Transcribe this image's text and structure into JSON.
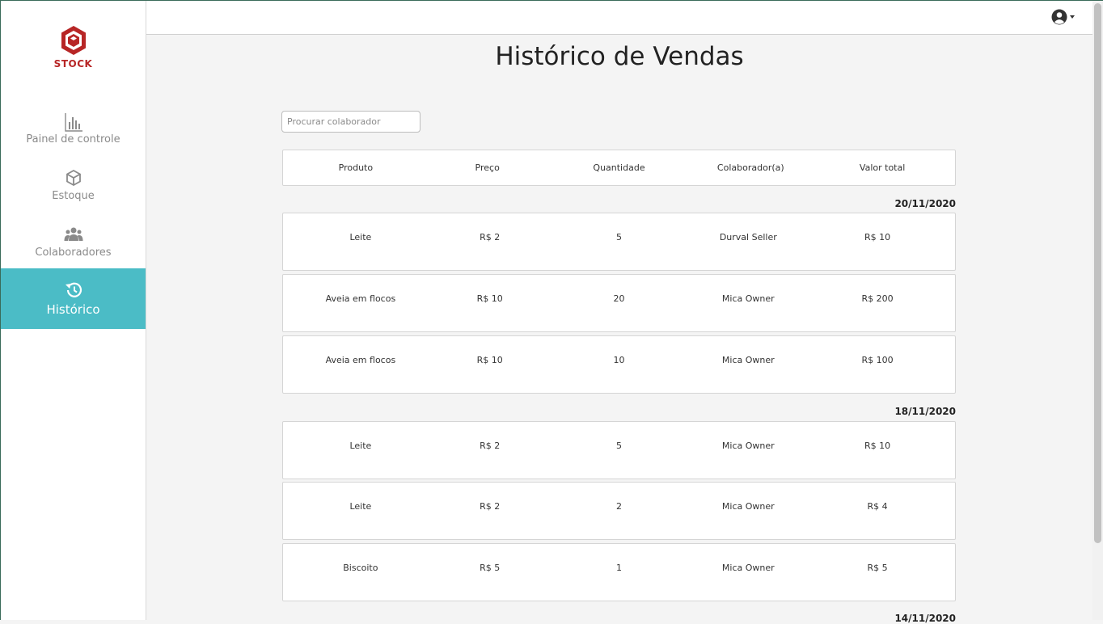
{
  "brand": {
    "name": "STOCK",
    "color": "#b72626"
  },
  "sidebar": {
    "items": [
      {
        "label": "Painel de controle",
        "icon": "bar-chart-icon"
      },
      {
        "label": "Estoque",
        "icon": "box-icon"
      },
      {
        "label": "Colaboradores",
        "icon": "users-icon"
      },
      {
        "label": "Histórico",
        "icon": "history-icon",
        "active": true
      }
    ],
    "active_color": "#4bbcc6"
  },
  "topbar": {
    "user_icon": "user-circle-icon"
  },
  "page": {
    "title": "Histórico de Vendas",
    "search_placeholder": "Procurar colaborador"
  },
  "table": {
    "columns": [
      "Produto",
      "Preço",
      "Quantidade",
      "Colaborador(a)",
      "Valor total"
    ],
    "groups": [
      {
        "date": "20/11/2020",
        "rows": [
          {
            "produto": "Leite",
            "preco": "R$ 2",
            "quantidade": "5",
            "colaborador": "Durval Seller",
            "total": "R$ 10"
          },
          {
            "produto": "Aveia em flocos",
            "preco": "R$ 10",
            "quantidade": "20",
            "colaborador": "Mica Owner",
            "total": "R$ 200"
          },
          {
            "produto": "Aveia em flocos",
            "preco": "R$ 10",
            "quantidade": "10",
            "colaborador": "Mica Owner",
            "total": "R$ 100"
          }
        ]
      },
      {
        "date": "18/11/2020",
        "rows": [
          {
            "produto": "Leite",
            "preco": "R$ 2",
            "quantidade": "5",
            "colaborador": "Mica Owner",
            "total": "R$ 10"
          },
          {
            "produto": "Leite",
            "preco": "R$ 2",
            "quantidade": "2",
            "colaborador": "Mica Owner",
            "total": "R$ 4"
          },
          {
            "produto": "Biscoito",
            "preco": "R$ 5",
            "quantidade": "1",
            "colaborador": "Mica Owner",
            "total": "R$ 5"
          }
        ]
      },
      {
        "date": "14/11/2020",
        "rows": []
      }
    ]
  }
}
